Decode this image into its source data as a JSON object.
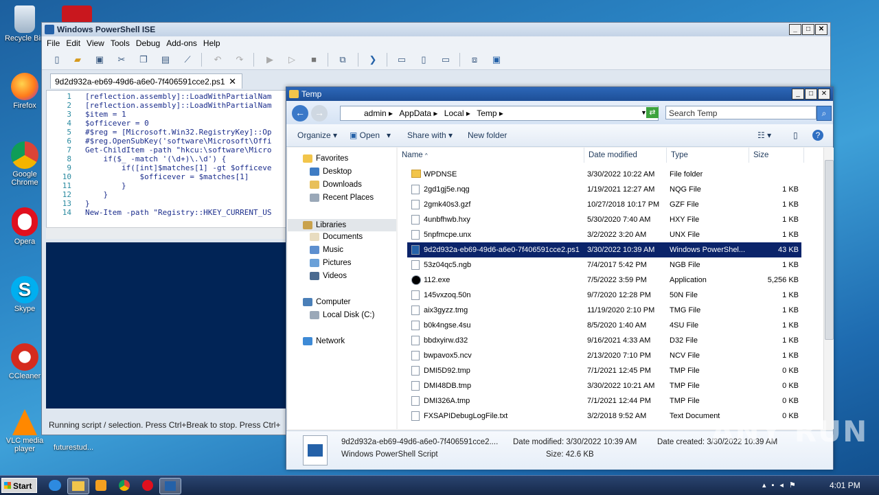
{
  "desktop": {
    "icons": [
      {
        "label": "Recycle Bin",
        "icon": "recycle-bin-icon"
      },
      {
        "label": "Firefox",
        "icon": "firefox-icon"
      },
      {
        "label": "Google Chrome",
        "icon": "chrome-icon"
      },
      {
        "label": "Opera",
        "icon": "opera-icon"
      },
      {
        "label": "Skype",
        "icon": "skype-icon"
      },
      {
        "label": "CCleaner",
        "icon": "ccleaner-icon"
      },
      {
        "label": "VLC media player",
        "icon": "vlc-icon"
      }
    ],
    "extra_label": "futurestud..."
  },
  "ise": {
    "title": "Windows PowerShell ISE",
    "menu": [
      "File",
      "Edit",
      "View",
      "Tools",
      "Debug",
      "Add-ons",
      "Help"
    ],
    "tab": "9d2d932a-eb69-49d6-a6e0-7f406591cce2.ps1",
    "line_numbers": "1\n2\n3\n4\n5\n6\n7\n8\n9\n10\n11\n12\n13\n14",
    "code": "[reflection.assembly]::LoadWithPartialNam\n[reflection.assembly]::LoadWithPartialNam\n$item = 1\n$officever = 0\n#$reg = [Microsoft.Win32.RegistryKey]::Op\n#$reg.OpenSubKey('software\\Microsoft\\Offi\nGet-ChildItem -path \"hkcu:\\software\\Micro\n    if($_ -match '(\\d+)\\.\\d') {\n        if([int]$matches[1] -gt $officeve\n            $officever = $matches[1]\n        }\n    }\n}\nNew-Item -path \"Registry::HKEY_CURRENT_US",
    "status": "Running script / selection.  Press Ctrl+Break to stop.  Press Ctrl+"
  },
  "explorer": {
    "title": "Temp",
    "breadcrumb": [
      "admin",
      "AppData",
      "Local",
      "Temp"
    ],
    "search_placeholder": "Search Temp",
    "commands": {
      "organize": "Organize",
      "open": "Open",
      "share": "Share with",
      "new_folder": "New folder"
    },
    "nav": {
      "favorites": "Favorites",
      "desktop": "Desktop",
      "downloads": "Downloads",
      "recent": "Recent Places",
      "libraries": "Libraries",
      "documents": "Documents",
      "music": "Music",
      "pictures": "Pictures",
      "videos": "Videos",
      "computer": "Computer",
      "local_disk": "Local Disk (C:)",
      "network": "Network"
    },
    "columns": {
      "name": "Name",
      "date": "Date modified",
      "type": "Type",
      "size": "Size"
    },
    "files": [
      {
        "name": "WPDNSE",
        "date": "3/30/2022 10:22 AM",
        "type": "File folder",
        "size": ""
      },
      {
        "name": "2gd1gj5e.nqg",
        "date": "1/19/2021 12:27 AM",
        "type": "NQG File",
        "size": "1 KB"
      },
      {
        "name": "2gmk40s3.gzf",
        "date": "10/27/2018 10:17 PM",
        "type": "GZF File",
        "size": "1 KB"
      },
      {
        "name": "4unbfhwb.hxy",
        "date": "5/30/2020 7:40 AM",
        "type": "HXY File",
        "size": "1 KB"
      },
      {
        "name": "5npfmcpe.unx",
        "date": "3/2/2022 3:20 AM",
        "type": "UNX File",
        "size": "1 KB"
      },
      {
        "name": "9d2d932a-eb69-49d6-a6e0-7f406591cce2.ps1",
        "date": "3/30/2022 10:39 AM",
        "type": "Windows PowerShel...",
        "size": "43 KB"
      },
      {
        "name": "53z04qc5.ngb",
        "date": "7/4/2017 5:42 PM",
        "type": "NGB File",
        "size": "1 KB"
      },
      {
        "name": "112.exe",
        "date": "7/5/2022 3:59 PM",
        "type": "Application",
        "size": "5,256 KB"
      },
      {
        "name": "145vxzoq.50n",
        "date": "9/7/2020 12:28 PM",
        "type": "50N File",
        "size": "1 KB"
      },
      {
        "name": "aix3gyzz.tmg",
        "date": "11/19/2020 2:10 PM",
        "type": "TMG File",
        "size": "1 KB"
      },
      {
        "name": "b0k4ngse.4su",
        "date": "8/5/2020 1:40 AM",
        "type": "4SU File",
        "size": "1 KB"
      },
      {
        "name": "bbdxyirw.d32",
        "date": "9/16/2021 4:33 AM",
        "type": "D32 File",
        "size": "1 KB"
      },
      {
        "name": "bwpavox5.ncv",
        "date": "2/13/2020 7:10 PM",
        "type": "NCV File",
        "size": "1 KB"
      },
      {
        "name": "DMI5D92.tmp",
        "date": "7/1/2021 12:45 PM",
        "type": "TMP File",
        "size": "0 KB"
      },
      {
        "name": "DMI48DB.tmp",
        "date": "3/30/2022 10:21 AM",
        "type": "TMP File",
        "size": "0 KB"
      },
      {
        "name": "DMI326A.tmp",
        "date": "7/1/2021 12:44 PM",
        "type": "TMP File",
        "size": "0 KB"
      },
      {
        "name": "FXSAPIDebugLogFile.txt",
        "date": "3/2/2018 9:52 AM",
        "type": "Text Document",
        "size": "0 KB"
      }
    ],
    "details": {
      "name": "9d2d932a-eb69-49d6-a6e0-7f406591cce2....",
      "type": "Windows PowerShell Script",
      "modified": "Date modified: 3/30/2022 10:39 AM",
      "size": "Size: 42.6 KB",
      "created": "Date created: 3/30/2022 10:39 AM"
    }
  },
  "taskbar": {
    "start": "Start",
    "clock": "4:01 PM"
  },
  "watermark": "ANY RUN"
}
